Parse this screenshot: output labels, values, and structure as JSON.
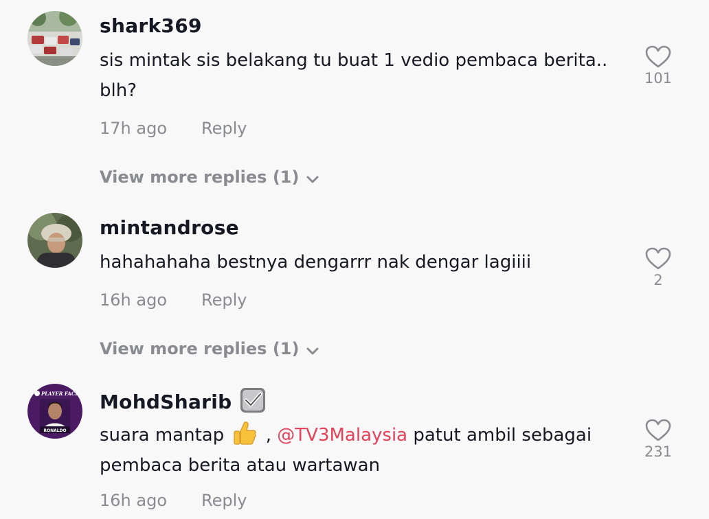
{
  "comments": [
    {
      "username": "shark369",
      "text": "sis mintak sis belakang tu buat 1 vedio pembaca berita.. blh?",
      "time": "17h ago",
      "reply_label": "Reply",
      "likes": "101",
      "view_more": "View more replies (1)",
      "verified": false
    },
    {
      "username": "mintandrose",
      "text": "hahahahaha bestnya dengarrr nak dengar lagiiii",
      "time": "16h ago",
      "reply_label": "Reply",
      "likes": "2",
      "view_more": "View more replies (1)",
      "verified": false
    },
    {
      "username": "MohdSharib",
      "text_before": "suara mantap",
      "emoji": "thumbs-up",
      "text_separator": ",",
      "mention": "@TV3Malaysia",
      "text_after": "patut ambil sebagai pembaca berita atau wartawan",
      "time": "16h ago",
      "reply_label": "Reply",
      "likes": "231",
      "verified": true,
      "avatar_text": "PLAYER FACES",
      "avatar_name": "RONALDO"
    }
  ],
  "colors": {
    "background": "#f8f8f8",
    "text": "#161823",
    "secondary": "#8a8b91",
    "mention": "#e5415a"
  }
}
